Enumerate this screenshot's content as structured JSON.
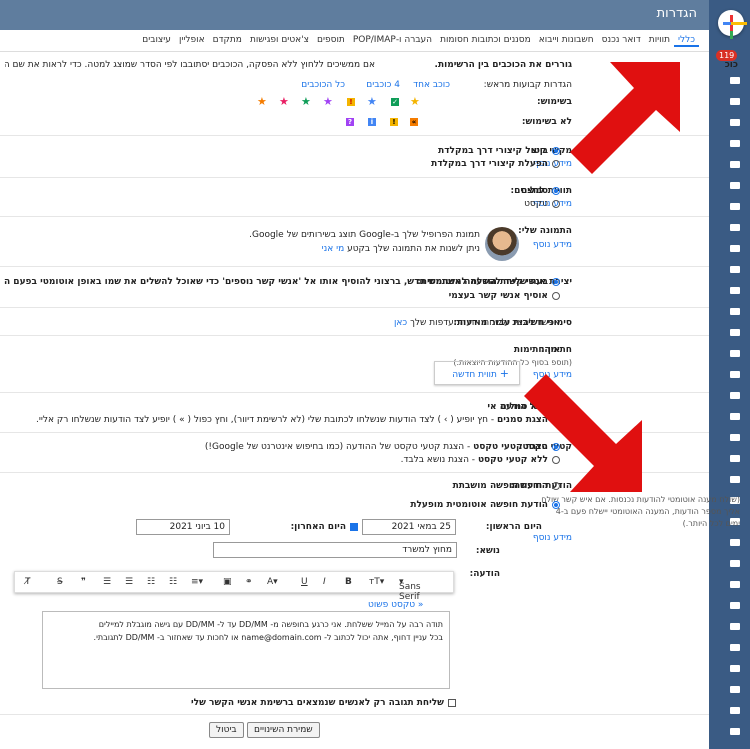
{
  "title": "הגדרות",
  "badge": "119",
  "tabs": [
    "כללי",
    "תוויות",
    "דואר נכנס",
    "חשבונות וייבוא",
    "מסננים וכתובות חסומות",
    "העברה ו-POP/IMAP",
    "תוספים",
    "צ'אטים ופגישות",
    "מתקדם",
    "אופליין",
    "עיצובים"
  ],
  "stars": {
    "label": "כוכ",
    "desc": "גוררים את הכוכבים בין הרשימות.",
    "desc2": "אם ממשיכים ללחוץ ללא הפסקה, הכוכבים יסתובבו לפי הסדר שמוצג למטה. כדי לראות את שם הכוכב שם",
    "presets_label": "הגדרות קבועות מראש:",
    "preset1": "כוכב אחד",
    "preset2": "4 כוכבים",
    "preset3": "כל הכוכבים",
    "in_use": "בשימוש:",
    "not_in_use": "לא בשימוש:"
  },
  "shortcuts": {
    "label": "מקשי קיצ",
    "more": "מידע נוסף",
    "opt1": "ביטול קיצורי דרך במקלדת",
    "opt2": "הפעלת קיצורי דרך במקלדת"
  },
  "buttons": {
    "label": "תוויות לחצנים:",
    "more": "מידע נוסף",
    "opt1": "סמלים",
    "opt2": "טקסט"
  },
  "picture": {
    "label": "התמונה שלי:",
    "more": "מידע נוסף",
    "line1": "תמונת הפרופיל שלך ב-Google תוצג בשירותים של Google.",
    "line2": "ניתן לשנות את התמונה שלך בקטע",
    "line2_link": "מי אני"
  },
  "contacts": {
    "label": "יצירת אנשי קשר להשלמה אוטומטית:",
    "opt1": "בעת שליחת הודעה למשתמש חדש, ברצוני להוסיף אותו אל 'אנשי קשר נוספים' כדי שאוכל להשלים את שמו באופן אוטומטי בפעם ה",
    "opt2": "אוסיף אנשי קשר בעצמי"
  },
  "importance": {
    "label": "סימוני חשיבות עבור מודעות:",
    "text": "אפשר להציג ולשנות את ההעדפות שלך",
    "link": "כאן"
  },
  "signature": {
    "label": "חתימה:",
    "hint": "(תוספ בסוף כל ההודעות היוצאות.)",
    "more": "מידע נוסף",
    "none": "אין חתימות",
    "new": "תווית חדשה"
  },
  "symbols": {
    "label": "סמלים של הודעה אי",
    "opt1": "ללא סמלים",
    "opt2": "הצגת סמנים",
    "opt2_text": "- חץ יופיע ( › ) לצד הודעות שנשלחו לכתובת שלי (לא לרשימת דיוור), וחץ כפול ( » ) יופיע לצד הודעות שנשלחו רק אליי."
  },
  "snippets": {
    "label": "קטעי טקסט:",
    "opt1": "הצגת קטעי טקסט",
    "opt1_text": "- הצגת קטעי טקסט של ההודעה (כמו בחיפוש אינטרנט של Google!)",
    "opt2": "ללא קטעי טקסט",
    "opt2_text": "- הצגת נושא בלבד."
  },
  "vacation": {
    "label": "הודעת חופשה:",
    "hint": "(שולח מענה אוטומטי להודעות נכנסות. אם איש קשר שולח אליך מספר הודעות, המענה האוטומטי יישלח פעם ב-4 ימים לכל היותר.)",
    "more": "מידע נוסף",
    "off": "הודעת חופשה מושבתת",
    "on": "הודעת חופשה אוטומטית מופעלת",
    "first_day": "היום הראשון:",
    "first_value": "25 במאי 2021",
    "last_day": "היום האחרון:",
    "last_value": "10 ביוני 2021",
    "subject_label": "נושא:",
    "subject": "מחוץ למשרד",
    "message_label": "הודעה:",
    "font": "Sans Serif",
    "plain": "« טקסט פשוט",
    "body1": "תודה רבה על המייל ששלחת. אני כרגע בחופשה מ- DD/MM עד ל- DD/MM עם גישה מוגבלת למיילים",
    "body2": "בכל עניין דחוף, אתה יכול לכתוב ל- name@domain.com או לחכות עד שאחזור ב- DD/MM לתגובתי.",
    "contacts_only": "שליחת תגובה רק לאנשים שנמצאים ברשימת אנשי הקשר שלי"
  },
  "save": "שמירת השינויים",
  "cancel": "ביטול"
}
